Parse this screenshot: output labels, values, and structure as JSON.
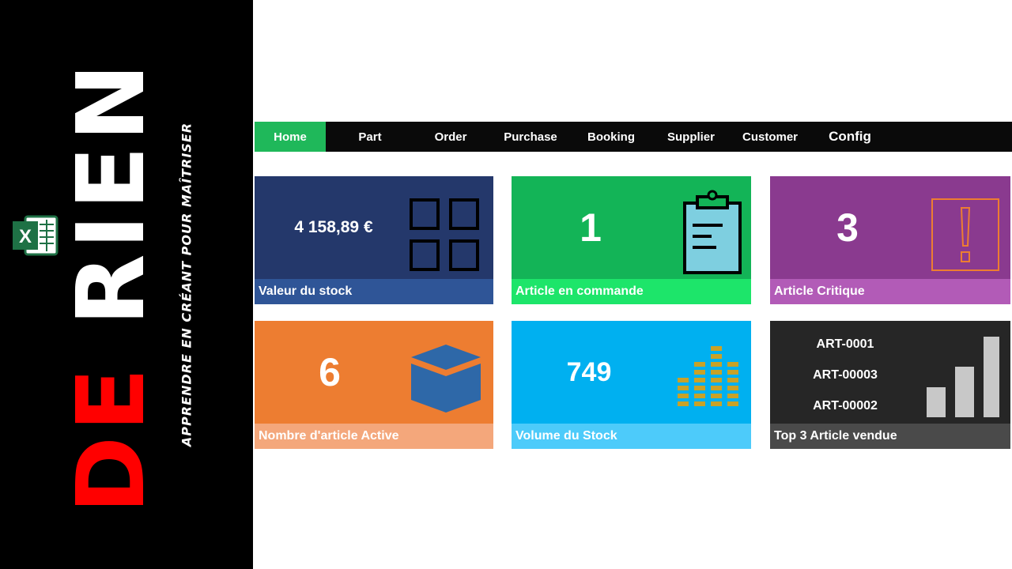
{
  "banner": {
    "title_part1": "DE",
    "title_part2": "RIEN",
    "tagline": "APPRENDRE EN CRÉANT POUR MAÎTRISER",
    "logo_letter": "X",
    "logo_icon": "excel-icon"
  },
  "nav": {
    "items": [
      {
        "label": "Home",
        "active": true
      },
      {
        "label": "Part"
      },
      {
        "label": "Order"
      },
      {
        "label": "Purchase"
      },
      {
        "label": "Booking"
      },
      {
        "label": "Supplier"
      },
      {
        "label": "Customer"
      },
      {
        "label": "Config"
      }
    ],
    "active_color": "#1fb85a"
  },
  "tiles": [
    {
      "value": "4 158,89 €",
      "label": "Valeur du stock",
      "icon": "grid-icon",
      "color": "#24386b"
    },
    {
      "value": "1",
      "label": "Article en commande",
      "icon": "clipboard-icon",
      "color": "#13b457"
    },
    {
      "value": "3",
      "label": "Article  Critique",
      "icon": "exclamation-icon",
      "color": "#8a3a8f"
    },
    {
      "value": "6",
      "label": "Nombre d'article Active",
      "icon": "box-icon",
      "color": "#ed7d31"
    },
    {
      "value": "749",
      "label": "Volume du Stock",
      "icon": "stack-bars-icon",
      "color": "#00b0f0"
    },
    {
      "label": "Top 3 Article vendue",
      "icon": "bar-chart-icon",
      "color": "#262626",
      "items": [
        "ART-0001",
        "ART-00003",
        "ART-00002"
      ]
    }
  ]
}
